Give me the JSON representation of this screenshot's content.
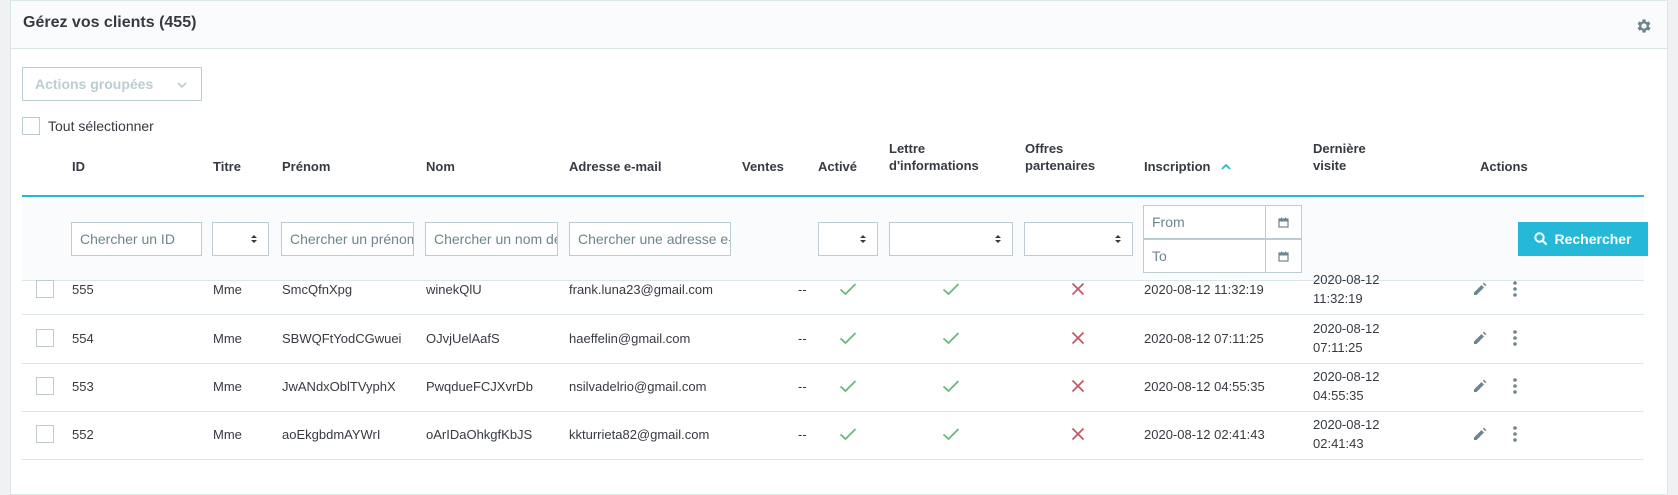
{
  "panel": {
    "title": "Gérez vos clients (455)",
    "settings_icon": "gear-icon"
  },
  "bulk_actions": {
    "label": "Actions groupées"
  },
  "select_all": {
    "label": "Tout sélectionner"
  },
  "columns": {
    "id": "ID",
    "title": "Titre",
    "firstname": "Prénom",
    "lastname": "Nom",
    "email": "Adresse e-mail",
    "sales": "Ventes",
    "active": "Activé",
    "newsletter_l1": "Lettre",
    "newsletter_l2": "d'informations",
    "optin_l1": "Offres",
    "optin_l2": "partenaires",
    "registration": "Inscription",
    "last_visit_l1": "Dernière",
    "last_visit_l2": "visite",
    "actions": "Actions"
  },
  "filters": {
    "id_placeholder": "Chercher un ID",
    "firstname_placeholder": "Chercher un prénom",
    "lastname_placeholder": "Chercher un nom de famille",
    "email_placeholder": "Chercher une adresse e-mail",
    "date_from_placeholder": "From",
    "date_to_placeholder": "To",
    "search_label": "Rechercher"
  },
  "colors": {
    "accent": "#25b9d7",
    "check": "#70b580",
    "cross": "#c05c67",
    "border": "#bbcdd2"
  },
  "rows": [
    {
      "id": "555",
      "title": "Mme",
      "firstname": "SmcQfnXpg",
      "lastname": "winekQlU",
      "email": "frank.luna23@gmail.com",
      "sales": "--",
      "active": true,
      "newsletter": true,
      "optin": false,
      "registration": "2020-08-12 11:32:19",
      "last_visit_date": "2020-08-12",
      "last_visit_time": "11:32:19"
    },
    {
      "id": "554",
      "title": "Mme",
      "firstname": "SBWQFtYodCGwuei",
      "lastname": "OJvjUelAafS",
      "email": "haeffelin@gmail.com",
      "sales": "--",
      "active": true,
      "newsletter": true,
      "optin": false,
      "registration": "2020-08-12 07:11:25",
      "last_visit_date": "2020-08-12",
      "last_visit_time": "07:11:25"
    },
    {
      "id": "553",
      "title": "Mme",
      "firstname": "JwANdxOblTVyphX",
      "lastname": "PwqdueFCJXvrDb",
      "email": "nsilvadelrio@gmail.com",
      "sales": "--",
      "active": true,
      "newsletter": true,
      "optin": false,
      "registration": "2020-08-12 04:55:35",
      "last_visit_date": "2020-08-12",
      "last_visit_time": "04:55:35"
    },
    {
      "id": "552",
      "title": "Mme",
      "firstname": "aoEkgbdmAYWrI",
      "lastname": "oArIDaOhkgfKbJS",
      "email": "kkturrieta82@gmail.com",
      "sales": "--",
      "active": true,
      "newsletter": true,
      "optin": false,
      "registration": "2020-08-12 02:41:43",
      "last_visit_date": "2020-08-12",
      "last_visit_time": "02:41:43"
    }
  ]
}
